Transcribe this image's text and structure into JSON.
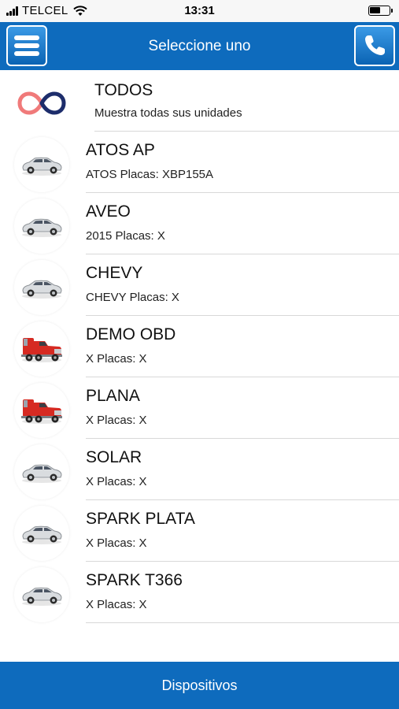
{
  "status": {
    "carrier": "TELCEL",
    "time": "13:31",
    "battery_level": 0.55
  },
  "header": {
    "title": "Seleccione uno",
    "menu_icon": "hamburger-menu-icon",
    "phone_icon": "phone-icon"
  },
  "todos": {
    "title": "TODOS",
    "subtitle": "Muestra todas sus unidades",
    "icon": "infinity-icon",
    "colors": [
      "#f07a7a",
      "#1d2d6b"
    ]
  },
  "devices": [
    {
      "name": "ATOS AP",
      "detail": "ATOS Placas: XBP155A",
      "icon": "car-icon"
    },
    {
      "name": "AVEO",
      "detail": "2015 Placas: X",
      "icon": "car-icon"
    },
    {
      "name": "CHEVY",
      "detail": "CHEVY Placas: X",
      "icon": "car-icon"
    },
    {
      "name": "DEMO OBD",
      "detail": "X Placas: X",
      "icon": "truck-icon"
    },
    {
      "name": "PLANA",
      "detail": "X Placas: X",
      "icon": "truck-icon"
    },
    {
      "name": "SOLAR",
      "detail": "X Placas: X",
      "icon": "car-icon"
    },
    {
      "name": "SPARK PLATA",
      "detail": "X Placas: X",
      "icon": "car-icon"
    },
    {
      "name": "SPARK T366",
      "detail": "X Placas: X",
      "icon": "car-icon"
    }
  ],
  "footer": {
    "label": "Dispositivos"
  },
  "colors": {
    "accent": "#0e6bbd",
    "car_body": "#d9dcdf",
    "truck_body": "#d62a22"
  }
}
